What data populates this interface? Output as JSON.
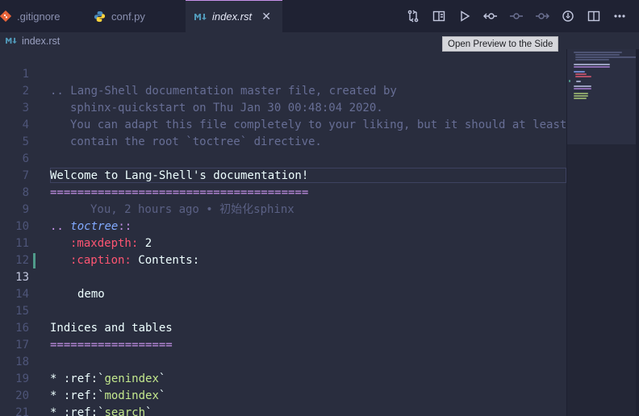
{
  "tabs": [
    {
      "label": ".gitignore",
      "icon": "git-icon"
    },
    {
      "label": "conf.py",
      "icon": "python-icon"
    },
    {
      "label": "index.rst",
      "icon": "markdown-icon",
      "active": true
    }
  ],
  "tab_close": "✕",
  "actions": [
    "compare-changes-icon",
    "open-preview-side-icon",
    "run-icon",
    "go-back-icon",
    "commit-dot-icon",
    "go-forward-icon",
    "timeline-icon",
    "split-editor-icon",
    "more-actions-icon"
  ],
  "breadcrumb": {
    "file": "index.rst"
  },
  "tooltip": "Open Preview to the Side",
  "editor": {
    "line_numbers": [
      "1",
      "2",
      "3",
      "4",
      "5",
      "6",
      "7",
      "8",
      "9",
      "10",
      "11",
      "12",
      "13",
      "14",
      "15",
      "16",
      "17",
      "18",
      "19",
      "20",
      "21"
    ],
    "active_line": "13",
    "l1": ".. Lang-Shell documentation master file, created by",
    "l2": "sphinx-quickstart on Thu Jan 30 00:48:04 2020.",
    "l3": "You can adapt this file completely to your liking, but it should at least",
    "l4": "contain the root `toctree` directive.",
    "l6": "Welcome to Lang-Shell's documentation!",
    "l7": "======================================",
    "l8_blame": "You, 2 hours ago • 初始化sphinx",
    "l9_prefix": "..",
    "l9_dir": "toctree",
    "l9_suffix": "::",
    "l10_field": ":maxdepth:",
    "l10_value": " 2",
    "l11_field": ":caption:",
    "l11_value": " Contents:",
    "l13": "demo",
    "l15": "Indices and tables",
    "l16": "==================",
    "l18_prefix": "* :ref:`",
    "l18_target": "genindex",
    "l18_suffix": "`",
    "l19_prefix": "* :ref:`",
    "l19_target": "modindex",
    "l19_suffix": "`",
    "l20_prefix": "* :ref:`",
    "l20_target": "search",
    "l20_suffix": "`"
  },
  "colors": {
    "background": "#292d3e",
    "comment": "#676e95",
    "keyword": "#c792ea",
    "directive": "#82aaff",
    "field": "#ff5572",
    "string": "#c3e88d",
    "git_modified": "#4f9b8a"
  }
}
